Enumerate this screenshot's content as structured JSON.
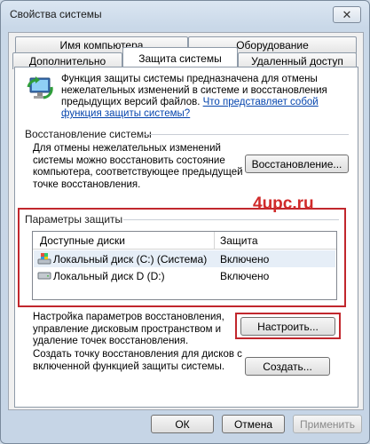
{
  "window": {
    "title": "Свойства системы",
    "close_glyph": "✕"
  },
  "tabs": {
    "row1": [
      "Имя компьютера",
      "Оборудование"
    ],
    "row2": [
      "Дополнительно",
      "Защита системы",
      "Удаленный доступ"
    ],
    "active": "Защита системы"
  },
  "intro": {
    "line1": "Функция защиты системы предназначена для отмены",
    "line2": "нежелательных изменений в системе и восстановления",
    "line3": "предыдущих версий файлов.",
    "link_part1": "Что представляет собой",
    "link_part2": "функция защиты системы?"
  },
  "restore": {
    "heading": "Восстановление системы",
    "desc1": "Для отмены нежелательных изменений",
    "desc2": "системы можно восстановить состояние",
    "desc3": "компьютера, соответствующее предыдущей",
    "desc4": "точке восстановления.",
    "button": "Восстановление..."
  },
  "watermark": "4upc.ru",
  "protection": {
    "heading": "Параметры защиты",
    "col_drives": "Доступные диски",
    "col_protection": "Защита",
    "rows": [
      {
        "drive": "Локальный диск (C:) (Система)",
        "status": "Включено",
        "icon": "system-drive-icon"
      },
      {
        "drive": "Локальный диск D (D:)",
        "status": "Включено",
        "icon": "drive-icon"
      }
    ]
  },
  "configure": {
    "desc1": "Настройка параметров восстановления,",
    "desc2": "управление дисковым пространством и",
    "desc3": "удаление точек восстановления.",
    "button": "Настроить..."
  },
  "create": {
    "desc1": "Создать точку восстановления для дисков с",
    "desc2": "включенной функцией защиты системы.",
    "button": "Создать..."
  },
  "footer": {
    "ok": "ОК",
    "cancel": "Отмена",
    "apply": "Применить"
  },
  "colors": {
    "highlight_red": "#c1272d",
    "link": "#0645ad"
  }
}
